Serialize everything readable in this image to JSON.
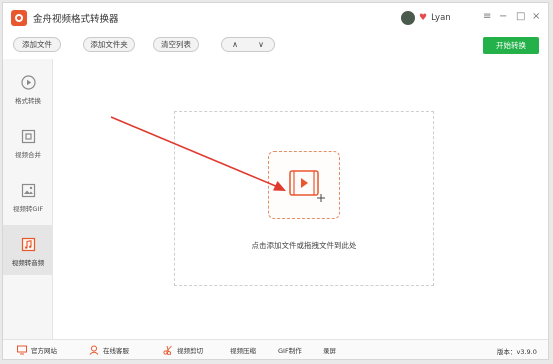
{
  "window": {
    "title": "金舟视频格式转换器",
    "user_name": "Lyan",
    "controls": [
      "≡",
      "−",
      "□",
      "×"
    ]
  },
  "toolbar": {
    "add_file": "添加文件",
    "add_folder": "添加文件夹",
    "clear_list": "清空列表",
    "move_up": "∧",
    "move_down": "∨",
    "start": "开始转换"
  },
  "sidebar": {
    "items": [
      {
        "label": "格式转换",
        "icon": "play-circle-icon",
        "active": false
      },
      {
        "label": "视频合并",
        "icon": "merge-icon",
        "active": false
      },
      {
        "label": "视频转GIF",
        "icon": "image-icon",
        "active": false
      },
      {
        "label": "视频转音频",
        "icon": "music-icon",
        "active": true
      }
    ]
  },
  "main": {
    "drop_hint": "点击添加文件或拖拽文件到此处"
  },
  "statusbar": {
    "items": [
      "官方网站",
      "在线客服",
      "视频剪切",
      "视频压缩",
      "GIF制作",
      "录屏"
    ],
    "version": "版本：v3.9.0"
  },
  "colors": {
    "accent_green": "#25b14a",
    "accent_orange": "#e8572e",
    "arrow_red": "#e03a2f"
  }
}
